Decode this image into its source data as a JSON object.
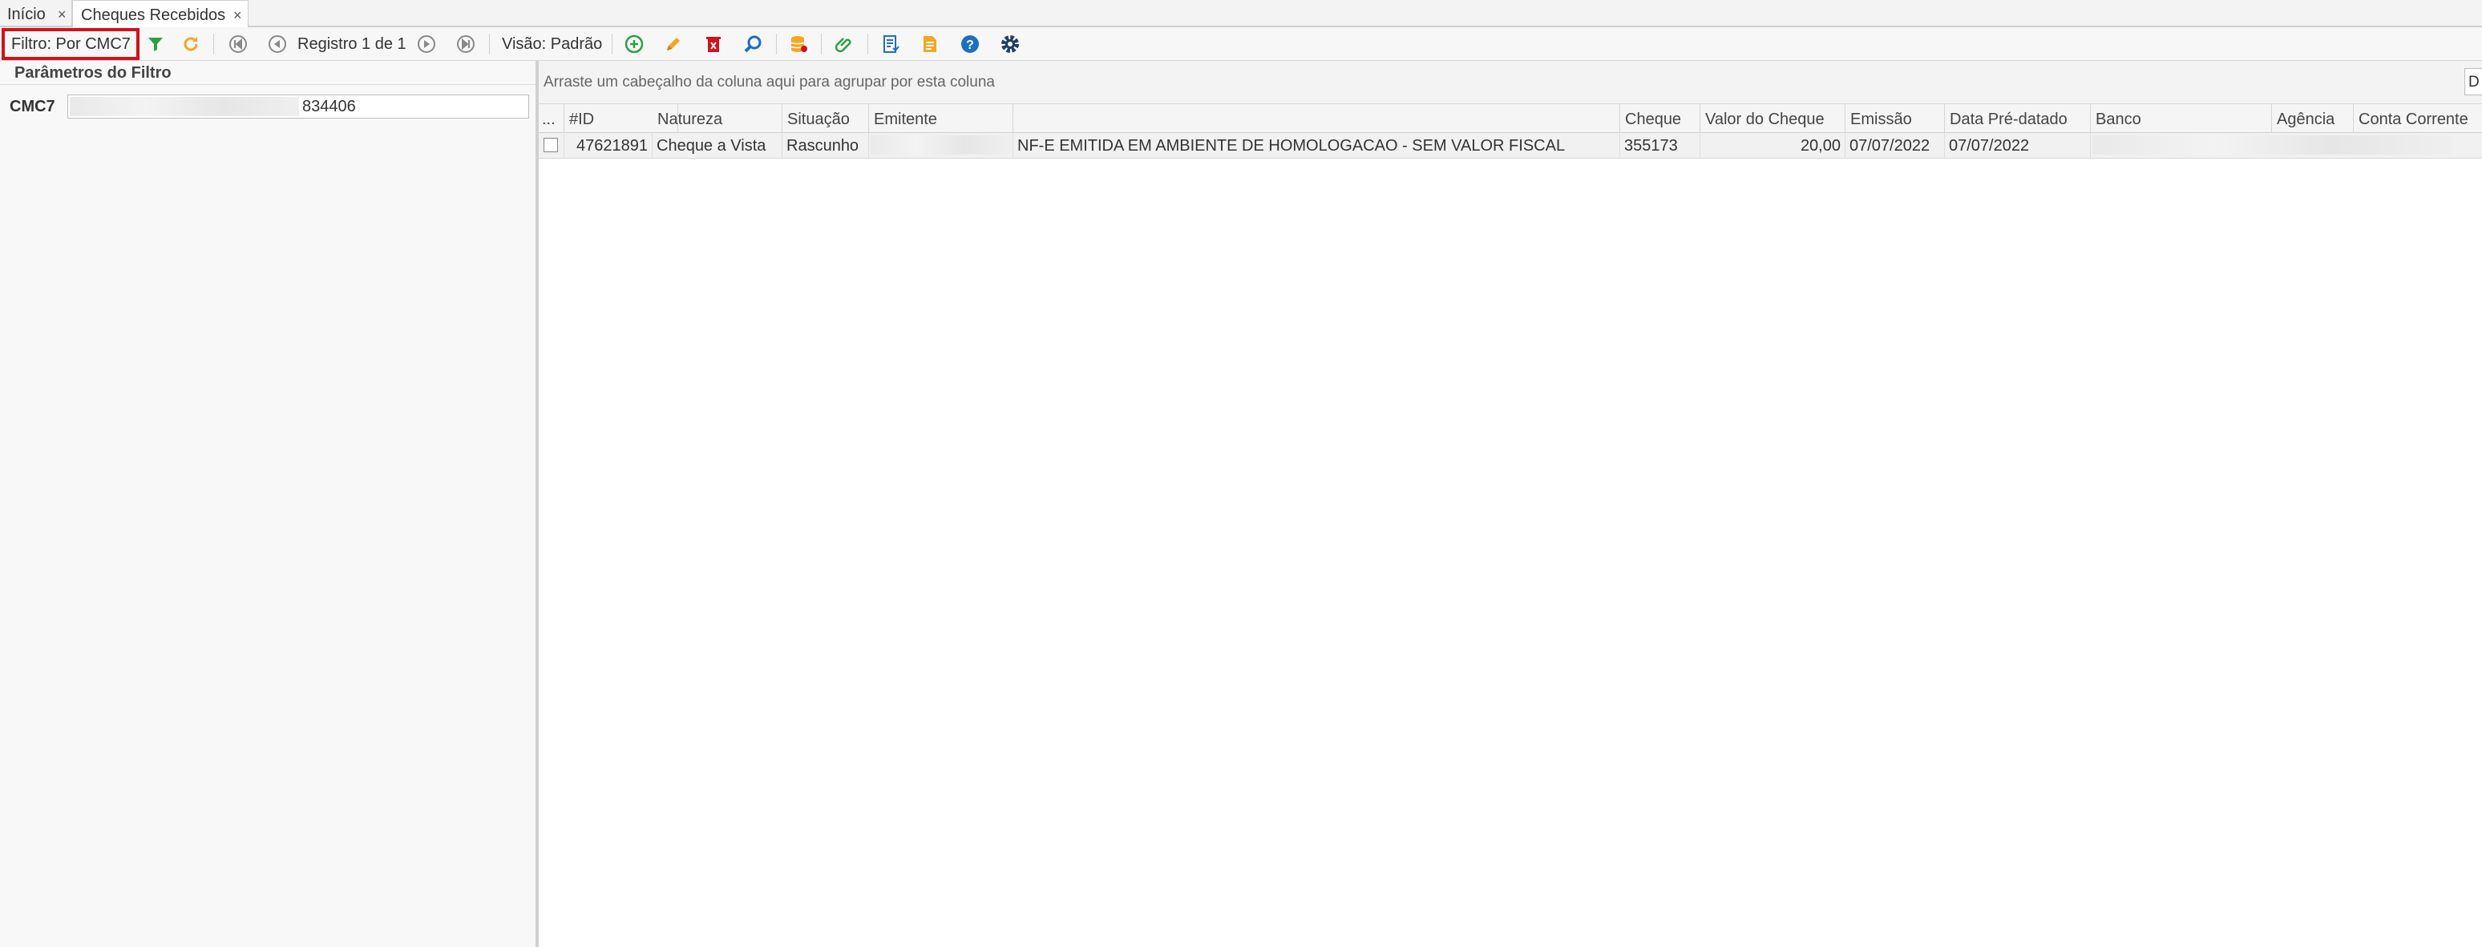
{
  "tabs": [
    {
      "label": "Início",
      "close": "×"
    },
    {
      "label": "Cheques Recebidos",
      "close": "×"
    }
  ],
  "toolbar": {
    "filter_label": "Filtro: Por CMC7",
    "record_label": "Registro 1 de 1",
    "view_label": "Visão: Padrão",
    "icons": [
      "filter-icon",
      "refresh-icon",
      "first-icon",
      "prev-icon",
      "next-icon",
      "last-icon",
      "add-icon",
      "edit-icon",
      "delete-icon",
      "search-icon",
      "database-icon",
      "attach-icon",
      "report-icon",
      "document-icon",
      "help-icon",
      "settings-icon"
    ]
  },
  "filter_panel": {
    "title": "Parâmetros do Filtro",
    "cmc7_label": "CMC7",
    "cmc7_value": "834406"
  },
  "grid": {
    "group_hint": "Arraste um cabeçalho da coluna aqui para agrupar por esta coluna",
    "group_box_text": "D",
    "columns": [
      "...",
      "#ID",
      "Natureza",
      "Situação",
      "Emitente",
      "",
      "Cheque",
      "Valor do Cheque",
      "Emissão",
      "Data Pré-datado",
      "Banco",
      "Agência",
      "Conta Corrente"
    ],
    "rows": [
      {
        "id": "47621891",
        "natureza": "Cheque a Vista",
        "situacao": "Rascunho",
        "emitente": "",
        "descricao": "NF-E EMITIDA EM AMBIENTE DE HOMOLOGACAO - SEM VALOR FISCAL",
        "cheque": "355173",
        "valor": "20,00",
        "emissao": "07/07/2022",
        "pre_datado": "07/07/2022",
        "banco": "",
        "agencia": "",
        "conta": ""
      }
    ]
  },
  "colors": {
    "accent_red": "#d0121b",
    "green": "#2ea043",
    "orange": "#f5a623",
    "blue": "#1a6fc4"
  }
}
